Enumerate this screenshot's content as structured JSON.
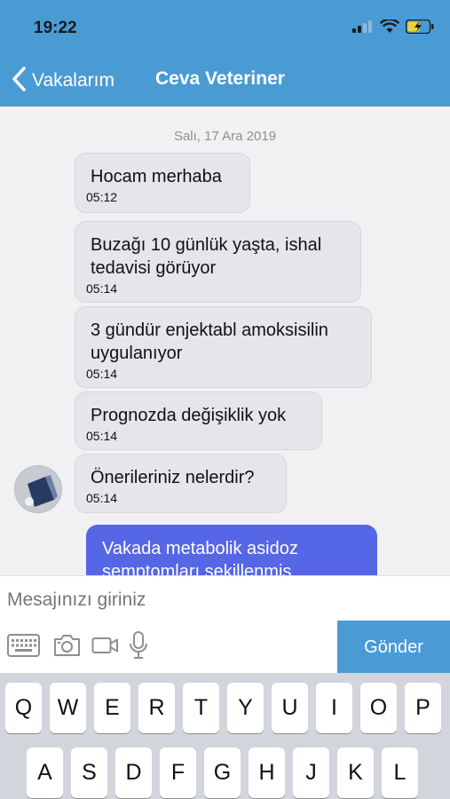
{
  "status_bar": {
    "time": "19:22"
  },
  "nav": {
    "back_label": "Vakalarım",
    "title": "Ceva Veteriner"
  },
  "chat": {
    "date": "Salı, 17 Ara 2019",
    "messages": [
      {
        "text": "Hocam merhaba",
        "time": "05:12"
      },
      {
        "text": "Buzağı 10 günlük yaşta, ishal tedavisi görüyor",
        "time": "05:14"
      },
      {
        "text": "3 gündür enjektabl amoksisilin uygulanıyor",
        "time": "05:14"
      },
      {
        "text": "Prognozda değişiklik yok",
        "time": "05:14"
      },
      {
        "text": "Önerileriniz nelerdir?",
        "time": "05:14"
      }
    ],
    "outgoing": {
      "text": "Vakada metabolik asidoz semptomları şekillenmiş"
    }
  },
  "composer": {
    "placeholder": "Mesajınızı giriniz",
    "send_label": "Gönder",
    "tools": [
      "keyboard-icon",
      "camera-icon",
      "video-icon",
      "microphone-icon"
    ]
  },
  "keyboard": {
    "row1": [
      "Q",
      "W",
      "E",
      "R",
      "T",
      "Y",
      "U",
      "I",
      "O",
      "P"
    ],
    "row2": [
      "A",
      "S",
      "D",
      "F",
      "G",
      "H",
      "J",
      "K",
      "L"
    ]
  },
  "colors": {
    "header": "#4a9bd4",
    "outgoing_bubble": "#5566e6",
    "incoming_bubble": "#e5e5ea",
    "send_button": "#4a9bd4"
  }
}
